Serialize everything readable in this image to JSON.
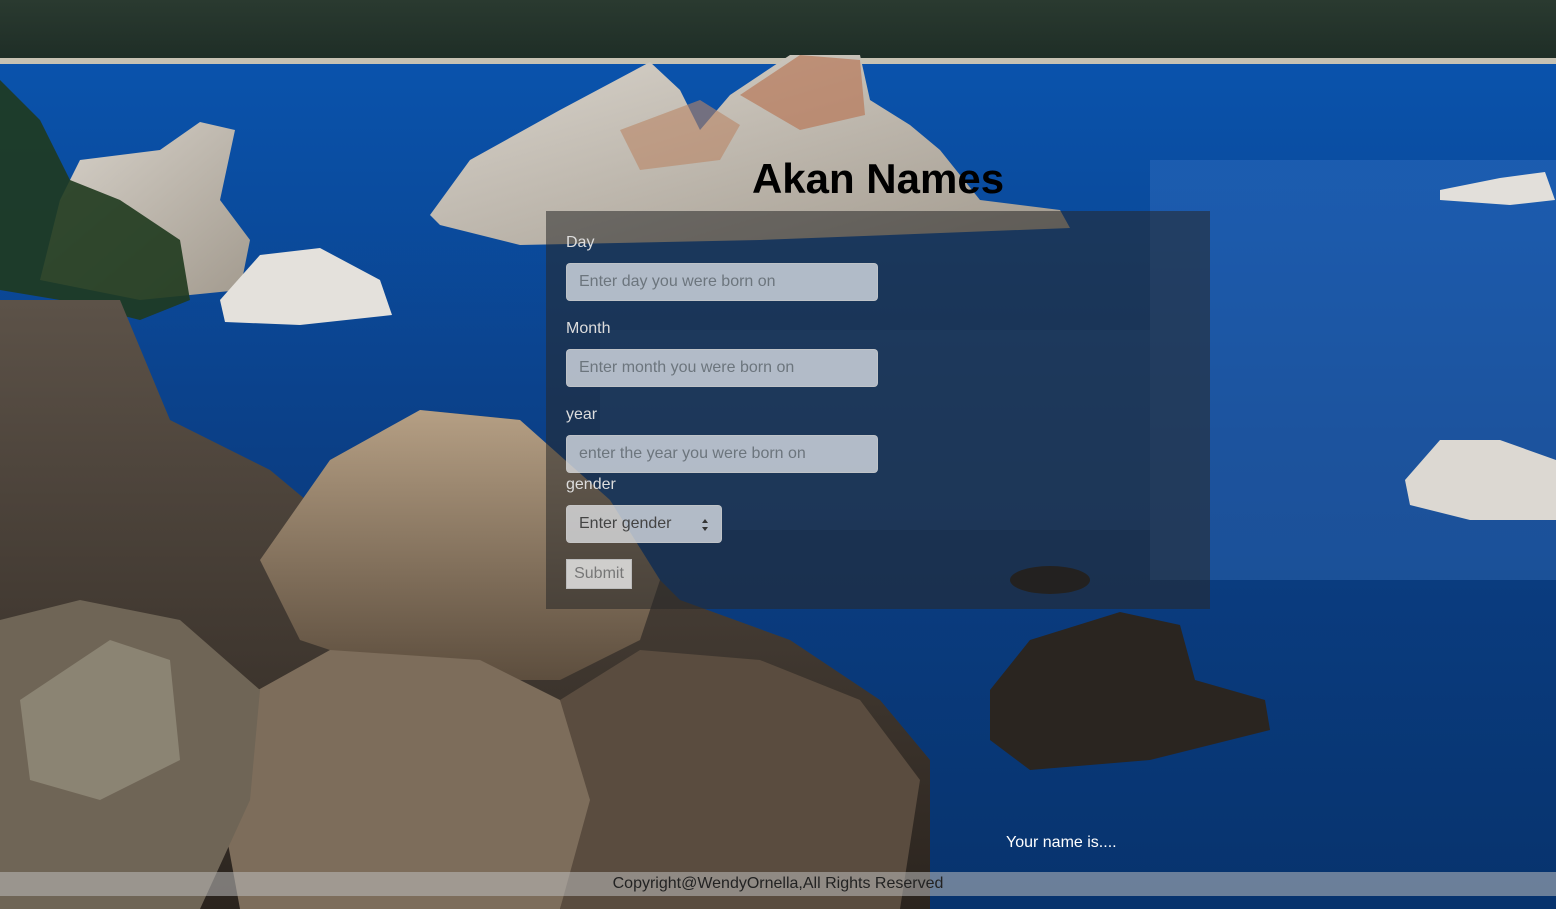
{
  "page": {
    "title": "Akan Names"
  },
  "form": {
    "day_label": "Day",
    "day_placeholder": "Enter day you were born on",
    "month_label": "Month",
    "month_placeholder": "Enter month you were born on",
    "year_label": "year",
    "year_placeholder": "enter the year you were born on",
    "gender_label": "gender",
    "gender_selected": "Enter gender",
    "submit_label": "Submit"
  },
  "result": {
    "text": "Your name is...."
  },
  "footer": {
    "text": "Copyright@WendyOrnella,All Rights Reserved"
  },
  "colors": {
    "lake": "#0b4a9a",
    "rock": "#8a7a66",
    "panel": "#333333"
  }
}
